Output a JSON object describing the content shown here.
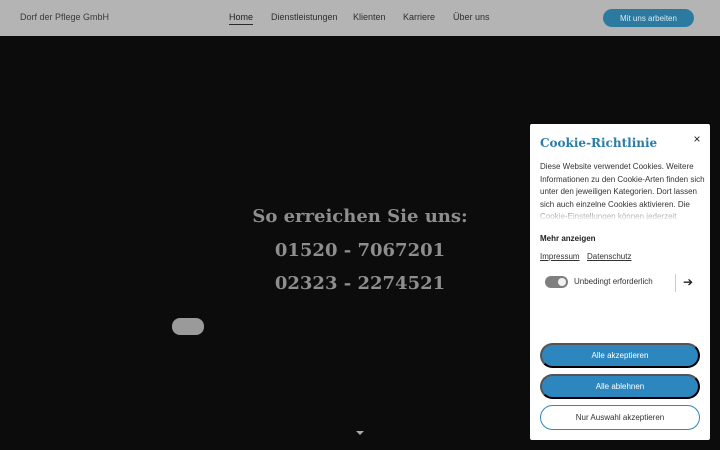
{
  "header": {
    "brand": "Dorf der Pflege GmbH",
    "nav": [
      {
        "label": "Home",
        "active": true
      },
      {
        "label": "Dienstleistungen",
        "active": false
      },
      {
        "label": "Klienten",
        "active": false
      },
      {
        "label": "Karriere",
        "active": false
      },
      {
        "label": "Über uns",
        "active": false
      }
    ],
    "cta_label": "Mit uns arbeiten"
  },
  "hero": {
    "title": "So erreichen Sie uns:",
    "phone_1": "01520 - 7067201",
    "phone_2": "02323 - 2274521"
  },
  "cookie": {
    "title": "Cookie-Richtlinie",
    "close_label": "×",
    "description": "Diese Website verwendet Cookies. Weitere Informationen zu den Cookie-Arten finden sich unter den jeweiligen Kategorien. Dort lassen sich auch einzelne Cookies aktivieren. Die Cookie-Einstellungen können jederzeit",
    "more_label": "Mehr anzeigen",
    "links": {
      "impressum": "Impressum",
      "datenschutz": "Datenschutz"
    },
    "category": {
      "label": "Unbedingt erforderlich",
      "enabled": true
    },
    "arrow_glyph": "➔",
    "buttons": {
      "accept_all": "Alle akzeptieren",
      "reject_all": "Alle ablehnen",
      "accept_selection": "Nur Auswahl akzeptieren"
    }
  },
  "colors": {
    "header_bg": "#b4b4b4",
    "page_bg": "#0c0c0c",
    "accent": "#2d86be",
    "title_accent": "#2a7da6"
  },
  "icons": {
    "close": "close-icon",
    "arrow": "arrow-right-icon",
    "scroll": "chevron-down-icon"
  }
}
